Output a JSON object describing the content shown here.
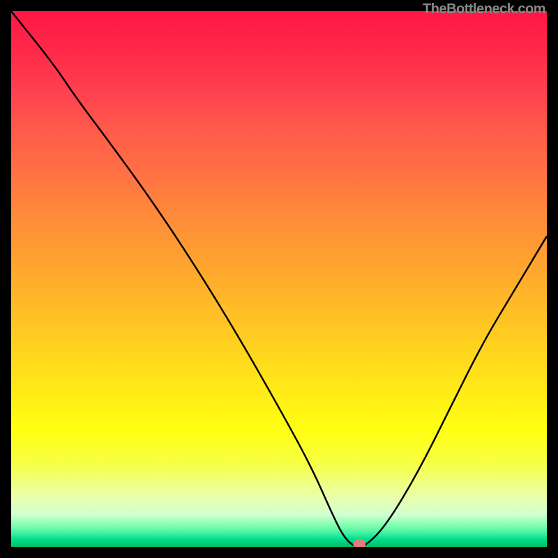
{
  "attribution": "TheBottleneck.com",
  "chart_data": {
    "type": "line",
    "title": "",
    "xlabel": "",
    "ylabel": "",
    "xlim": [
      0,
      100
    ],
    "ylim": [
      0,
      100
    ],
    "series": [
      {
        "name": "bottleneck-curve",
        "x": [
          0,
          8,
          12,
          18,
          26,
          34,
          42,
          50,
          56,
          60,
          62,
          64,
          66,
          70,
          76,
          82,
          88,
          94,
          100
        ],
        "values": [
          100,
          90,
          84,
          76,
          65,
          53,
          40,
          26,
          15,
          6,
          2,
          0,
          0,
          4,
          14,
          26,
          38,
          48,
          58
        ]
      }
    ],
    "marker": {
      "x": 65,
      "y": 0
    },
    "gradient_zones": [
      {
        "color": "#ff1744",
        "meaning": "severe-bottleneck",
        "y_pct": 0
      },
      {
        "color": "#ffb300",
        "meaning": "moderate-bottleneck",
        "y_pct": 50
      },
      {
        "color": "#ffff00",
        "meaning": "mild-bottleneck",
        "y_pct": 80
      },
      {
        "color": "#00e676",
        "meaning": "no-bottleneck",
        "y_pct": 100
      }
    ]
  }
}
